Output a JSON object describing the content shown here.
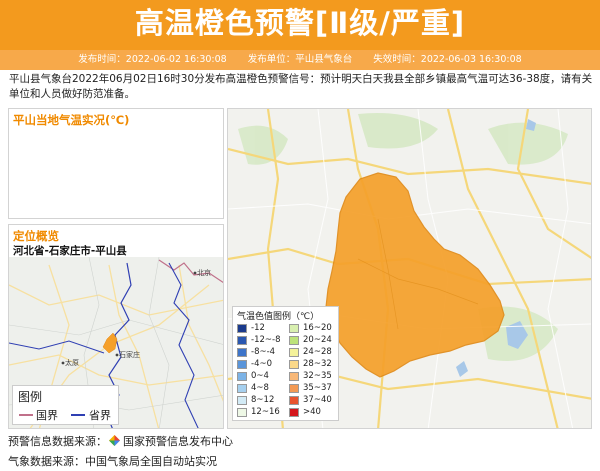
{
  "header": {
    "title": "高温橙色预警[Ⅱ级/严重]",
    "publish_time": "发布时间：2022-06-02 16:30:08",
    "publisher": "发布单位：平山县气象台",
    "expire_time": "失效时间：2022-06-03 16:30:08"
  },
  "description": "平山县气象台2022年06月02日16时30分发布高温橙色预警信号：预计明天白天我县全部乡镇最高气温可达36-38度，请有关单位和人员做好防范准备。",
  "temp_panel": {
    "title": "平山当地气温实况(℃)"
  },
  "location_panel": {
    "title": "定位概览",
    "location": "河北省-石家庄市-平山县",
    "city_labels": {
      "beijing": "北京",
      "shijiazhuang": "石家庄",
      "taiyuan": "太原"
    },
    "legend_title": "图例",
    "legend_items": [
      {
        "label": "国界",
        "color": "#c0708a"
      },
      {
        "label": "省界",
        "color": "#2f3fb3"
      }
    ]
  },
  "map_legend": {
    "title": "气温色值图例（℃）",
    "items": [
      {
        "label": "-12",
        "color": "#1b3a8c"
      },
      {
        "label": "-12~-8",
        "color": "#2a57b0"
      },
      {
        "label": "-8~-4",
        "color": "#3d74c9"
      },
      {
        "label": "-4~0",
        "color": "#5a95da"
      },
      {
        "label": "0~4",
        "color": "#7cb3e6"
      },
      {
        "label": "4~8",
        "color": "#a6d0ef"
      },
      {
        "label": "8~12",
        "color": "#d3ebf6"
      },
      {
        "label": "12~16",
        "color": "#eef8e6"
      },
      {
        "label": "16~20",
        "color": "#d9f0b0"
      },
      {
        "label": "20~24",
        "color": "#bde37a"
      },
      {
        "label": "24~28",
        "color": "#f4f29a"
      },
      {
        "label": "28~32",
        "color": "#fbd98a"
      },
      {
        "label": "32~35",
        "color": "#f8b878"
      },
      {
        "label": "35~37",
        "color": "#f39a54"
      },
      {
        "label": "37~40",
        "color": "#e8542e"
      },
      {
        "label": ">40",
        "color": "#d4161c"
      }
    ]
  },
  "sources": {
    "warning_label": "预警信息数据来源：",
    "warning_source": "国家预警信息发布中心",
    "weather_label": "气象数据来源：",
    "weather_source": "中国气象局全国自动站实况"
  },
  "colors": {
    "header": "#f39a1e",
    "subbar": "#f7a94a",
    "accent": "#f08a00",
    "warning_area": "#f5a02a"
  }
}
